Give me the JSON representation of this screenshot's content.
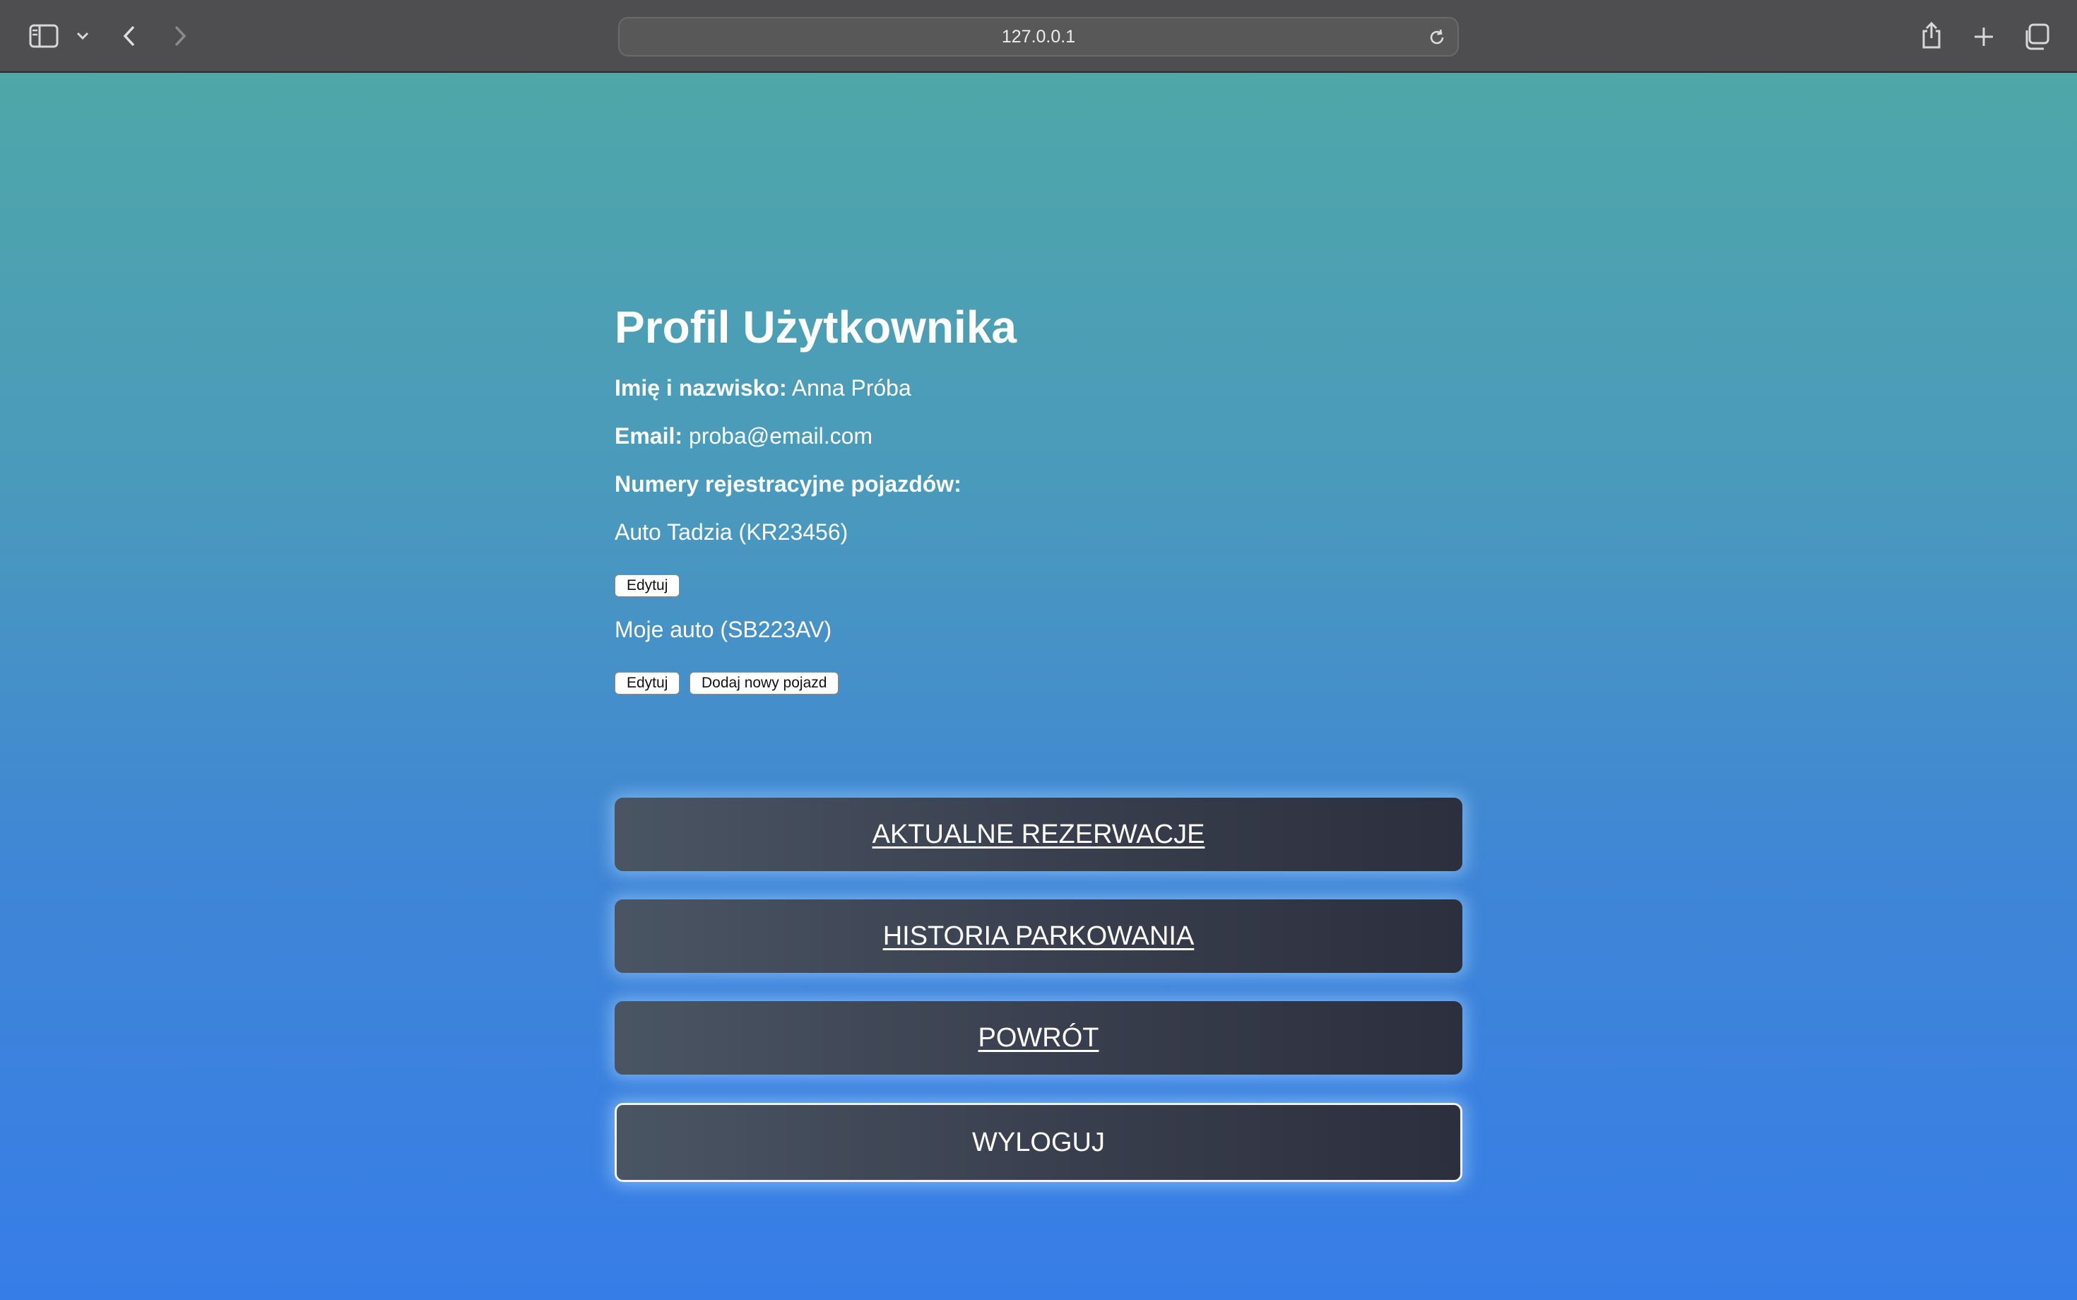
{
  "browser": {
    "url": "127.0.0.1",
    "icons": [
      "sidebar-icon",
      "chevron-down-icon",
      "back-icon",
      "forward-icon",
      "reload-icon",
      "share-icon",
      "new-tab-icon",
      "tabs-overview-icon"
    ]
  },
  "profile": {
    "title": "Profil Użytkownika",
    "name_label": "Imię i nazwisko:",
    "name_value": "Anna Próba",
    "email_label": "Email:",
    "email_value": "proba@email.com",
    "vehicles_label": "Numery rejestracyjne pojazdów:",
    "vehicles": [
      {
        "label": "Auto Tadzia (KR23456)",
        "edit_label": "Edytuj"
      },
      {
        "label": "Moje auto (SB223AV)",
        "edit_label": "Edytuj"
      }
    ],
    "add_vehicle_label": "Dodaj nowy pojazd"
  },
  "actions": {
    "current_reservations": "AKTUALNE REZERWACJE",
    "parking_history": "HISTORIA PARKOWANIA",
    "back": "POWRÓT",
    "logout": "WYLOGUJ"
  }
}
